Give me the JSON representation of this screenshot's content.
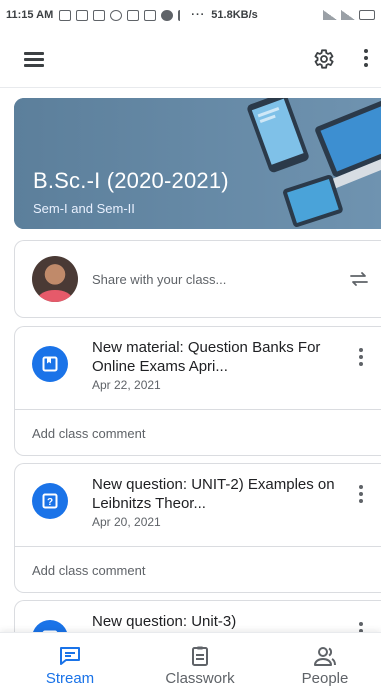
{
  "status_bar": {
    "time": "11:15 AM",
    "dots": "···",
    "net_speed": "51.8KB/s"
  },
  "app_bar": {
    "icons": [
      "menu-icon",
      "settings-icon",
      "more-vertical-icon"
    ]
  },
  "banner": {
    "title": "B.Sc.-I (2020-2021)",
    "subtitle": "Sem-I and Sem-II",
    "color": "#5a7d99"
  },
  "share": {
    "placeholder": "Share with your class..."
  },
  "posts": [
    {
      "icon": "material-icon",
      "title": "New material: Question Banks For Online Exams Apri...",
      "date": "Apr 22, 2021",
      "comment_label": "Add class comment"
    },
    {
      "icon": "question-icon",
      "title": "New question: UNIT-2) Examples on Leibnitzs Theor...",
      "date": "Apr 20, 2021",
      "comment_label": "Add class comment"
    },
    {
      "icon": "question-icon",
      "title": "New question: Unit-3)"
    }
  ],
  "bottom_nav": {
    "items": [
      {
        "label": "Stream",
        "icon": "stream-icon",
        "active": true
      },
      {
        "label": "Classwork",
        "icon": "classwork-icon",
        "active": false
      },
      {
        "label": "People",
        "icon": "people-icon",
        "active": false
      }
    ]
  },
  "colors": {
    "accent": "#1a73e8",
    "text_secondary": "#5f6368",
    "border": "#dadce0"
  }
}
